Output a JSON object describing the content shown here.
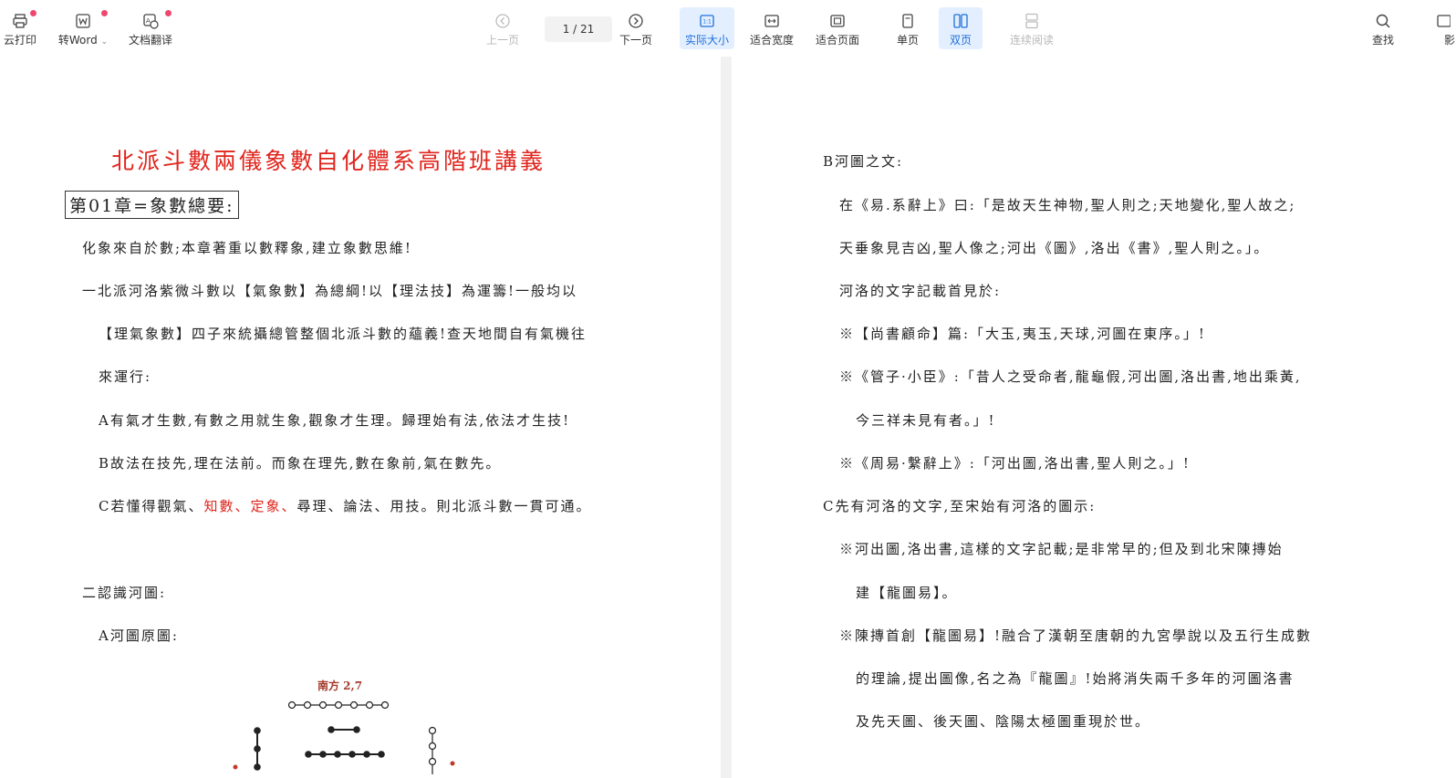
{
  "toolbar": {
    "cloud_print": "云打印",
    "to_word": "转Word",
    "doc_translate": "文档翻译",
    "prev_page": "上一页",
    "page_indicator": "1  / 21",
    "next_page": "下一页",
    "actual_size": "实际大小",
    "fit_width": "适合宽度",
    "fit_page": "适合页面",
    "single_page": "单页",
    "double_page": "双页",
    "continuous": "连续阅读",
    "find": "查找",
    "cut_label": "影"
  },
  "left_page": {
    "title": "北派斗數兩儀象數自化體系高階班講義",
    "chapter": "第01章=象數總要:",
    "line1": "化象來自於數;本章著重以數釋象,建立象數思維!",
    "line2": "一北派河洛紫微斗數以【氣象數】為總綱!以【理法技】為運籌!一般均以",
    "line3": "【理氣象數】四子來統攝總管整個北派斗數的蘊義!查天地間自有氣機往",
    "line4": "來運行:",
    "lineA": "A有氣才生數,有數之用就生象,觀象才生理。歸理始有法,依法才生技!",
    "lineB": "B故法在技先,理在法前。而象在理先,數在象前,氣在數先。",
    "lineC_pre": "C若懂得觀氣、",
    "lineC_red": "知數、定象、",
    "lineC_post": "尋理、論法、用技。則北派斗數一貫可通。",
    "line2b": "二認識河圖:",
    "lineA2": "A河圖原圖:",
    "diagram_south": "南方  2,7"
  },
  "right_page": {
    "r1": "B河圖之文:",
    "r2": "在《易.系辭上》曰:「是故天生神物,聖人則之;天地變化,聖人故之;",
    "r3": "天垂象見吉凶,聖人像之;河出《圖》,洛出《書》,聖人則之。」。",
    "r4": "河洛的文字記載首見於:",
    "r5": "※【尚書顧命】篇:「大玉,夷玉,天球,河圖在東序。」!",
    "r6": "※《管子·小臣》:「昔人之受命者,龍龜假,河出圖,洛出書,地出乘黃,",
    "r7": "今三祥未見有者。」!",
    "r8": "※《周易·繫辭上》:「河出圖,洛出書,聖人則之。」!",
    "r9": "C先有河洛的文字,至宋始有河洛的圖示:",
    "r10": "※河出圖,洛出書,這樣的文字記載;是非常早的;但及到北宋陳摶始",
    "r11": "建【龍圖易】。",
    "r12": "※陳摶首創【龍圖易】!融合了漢朝至唐朝的九宮學說以及五行生成數",
    "r13": "的理論,提出圖像,名之為『龍圖』!始將消失兩千多年的河圖洛書",
    "r14": "及先天圖、後天圖、陰陽太極圖重現於世。"
  }
}
